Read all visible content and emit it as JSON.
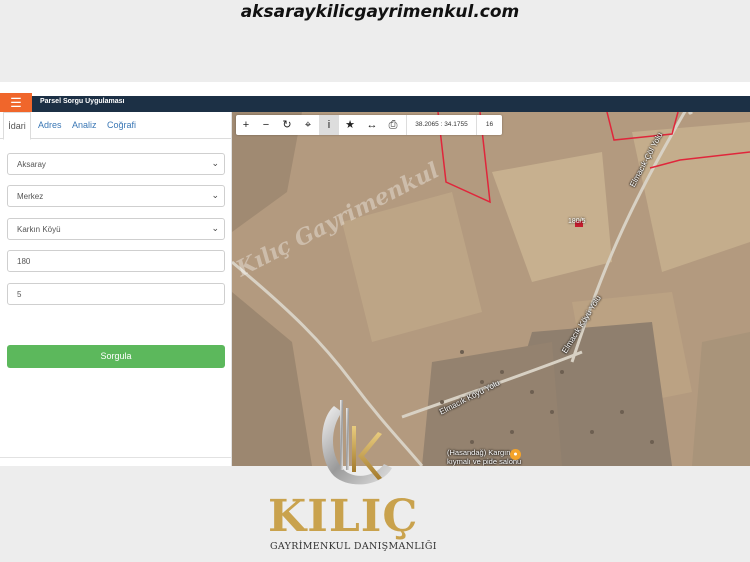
{
  "watermark_top": "aksaraykilicgayrimenkul.com",
  "app": {
    "title": "Parsel Sorgu Uygulaması",
    "menu_icon": "hamburger-icon"
  },
  "sidebar": {
    "tabs": [
      "İdari",
      "Adres",
      "Analiz",
      "Coğrafi"
    ],
    "province": "Aksaray",
    "district": "Merkez",
    "neighborhood": "Karkın Köyü",
    "block": "180",
    "parcel": "5",
    "submit_label": "Sorgula"
  },
  "toolbar": {
    "coords": "38.2065 : 34.1755",
    "zoom": "16",
    "icons": [
      "zoom-in-icon",
      "zoom-out-icon",
      "refresh-icon",
      "locate-icon",
      "info-icon",
      "favorite-icon",
      "measure-icon",
      "print-icon"
    ]
  },
  "map": {
    "watermark": "Kılıç Gayrimenkul",
    "parcel_label": "180/5",
    "road_labels": [
      "Elmacık-Çöl Yolu",
      "Elmacık Köyü Yolu",
      "Elmacık Köyü Yolu"
    ],
    "poi_line1": "(Hasandağ) Kargın",
    "poi_line2": "kıymalı ve pide salonu",
    "parcel_color": "#e0263b"
  },
  "branding": {
    "name": "KILIÇ",
    "subtitle": "GAYRİMENKUL DANIŞMANLIĞI",
    "gold": "#c9a24d"
  }
}
